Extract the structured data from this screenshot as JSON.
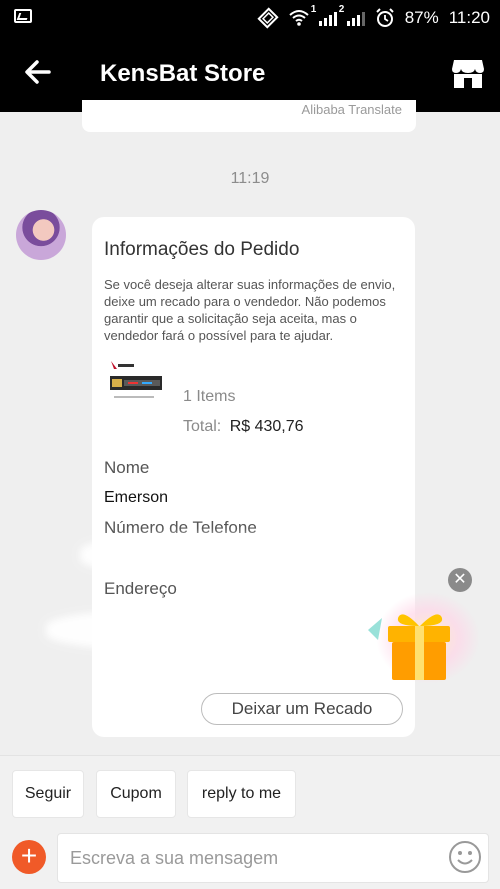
{
  "status_bar": {
    "battery": "87%",
    "time": "11:20",
    "sim1": "1",
    "sim2": "2"
  },
  "app_bar": {
    "title": "KensBat Store",
    "back_icon": "arrow-left-icon",
    "store_icon": "store-icon"
  },
  "previous_message": {
    "footer": "Alibaba Translate"
  },
  "chat": {
    "timestamp": "11:19"
  },
  "order_card": {
    "title": "Informações do Pedido",
    "description": "Se você deseja alterar suas informações de envio, deixe um recado para o vendedor. Não podemos garantir que a solicitação seja aceita, mas o vendedor fará o possível para te ajudar.",
    "items_count": "1 Items",
    "total_label": "Total:",
    "total_value": "R$ 430,76",
    "name_label": "Nome",
    "name_value": "Emerson",
    "phone_label": "Número de Telefone",
    "address_label": "Endereço",
    "leave_note_button": "Deixar um Recado"
  },
  "quick_replies": [
    "Seguir",
    "Cupom",
    "reply to me"
  ],
  "composer": {
    "placeholder": "Escreva a sua mensagem",
    "add_icon": "plus-icon",
    "emoji_icon": "smiley-icon"
  },
  "colors": {
    "header_bg": "#000000",
    "accent": "#f05a28",
    "page_bg": "#efefef"
  }
}
